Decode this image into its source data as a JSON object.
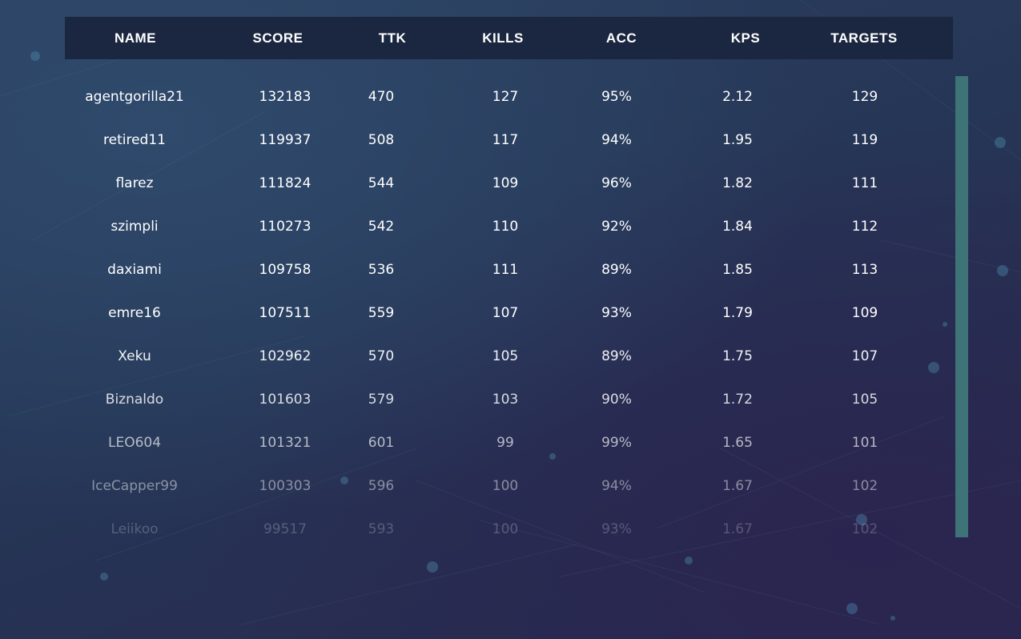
{
  "leaderboard": {
    "columns": [
      "NAME",
      "SCORE",
      "TTK",
      "KILLS",
      "ACC",
      "KPS",
      "TARGETS"
    ],
    "rows": [
      [
        "agentgorilla21",
        "132183",
        "470",
        "127",
        "95%",
        "2.12",
        "129"
      ],
      [
        "retired11",
        "119937",
        "508",
        "117",
        "94%",
        "1.95",
        "119"
      ],
      [
        "flarez",
        "111824",
        "544",
        "109",
        "96%",
        "1.82",
        "111"
      ],
      [
        "szimpli",
        "110273",
        "542",
        "110",
        "92%",
        "1.84",
        "112"
      ],
      [
        "daxiami",
        "109758",
        "536",
        "111",
        "89%",
        "1.85",
        "113"
      ],
      [
        "emre16",
        "107511",
        "559",
        "107",
        "93%",
        "1.79",
        "109"
      ],
      [
        "Xeku",
        "102962",
        "570",
        "105",
        "89%",
        "1.75",
        "107"
      ],
      [
        "Biznaldo",
        "101603",
        "579",
        "103",
        "90%",
        "1.72",
        "105"
      ],
      [
        "LEO604",
        "101321",
        "601",
        "99",
        "99%",
        "1.65",
        "101"
      ],
      [
        "IceCapper99",
        "100303",
        "596",
        "100",
        "94%",
        "1.67",
        "102"
      ],
      [
        "Leiikoo",
        "99517",
        "593",
        "100",
        "93%",
        "1.67",
        "102"
      ]
    ]
  },
  "colors": {
    "header_bg": "#1b2740",
    "scrollbar": "#3e7377",
    "text": "#ffffff"
  }
}
